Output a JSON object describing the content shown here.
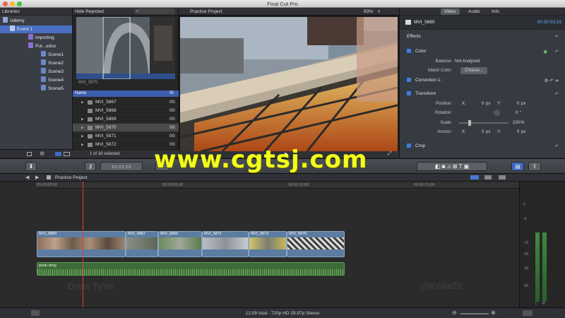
{
  "window": {
    "title": "Final Cut Pro"
  },
  "libraries": {
    "header": "Libraries",
    "items": [
      {
        "label": "Udemy"
      },
      {
        "label": "Event 1"
      },
      {
        "label": "importing"
      },
      {
        "label": "Put...edux"
      },
      {
        "label": "Scene1"
      },
      {
        "label": "Scene2"
      },
      {
        "label": "Scene3"
      },
      {
        "label": "Scene4"
      },
      {
        "label": "Scene5"
      }
    ]
  },
  "browser": {
    "filter": "Hide Rejected",
    "filmstrip_label": "MVI_5870",
    "columns": {
      "name": "Name",
      "status": "St"
    },
    "rows": [
      {
        "name": "MVI_5867",
        "status": "00:"
      },
      {
        "name": "MVI_5868",
        "status": "00:"
      },
      {
        "name": "MVI_5869",
        "status": "00:"
      },
      {
        "name": "MVI_5870",
        "status": "00:"
      },
      {
        "name": "MVI_5871",
        "status": "00:"
      },
      {
        "name": "MVI_5872",
        "status": "00:"
      }
    ],
    "selection": "1 of 16 selected"
  },
  "viewer": {
    "project": "Practice Project",
    "zoom": "93%"
  },
  "inspector": {
    "tabs": [
      "Video",
      "Audio",
      "Info"
    ],
    "clip_name": "MVI_5880",
    "timecode": "00:00:03;16",
    "effects": "Effects",
    "color": {
      "title": "Color",
      "balance_label": "Balance:",
      "balance_value": "Not Analyzed",
      "match_label": "Match Color:",
      "choose": "Choose..."
    },
    "correction": "Correction 1:",
    "transform": {
      "title": "Transform",
      "position_label": "Position:",
      "x_label": "X:",
      "x_val": "0",
      "y_label": "Y:",
      "y_val": "0",
      "px": "px",
      "rotation_label": "Rotation:",
      "rotation_val": "0",
      "deg": "°",
      "scale_label": "Scale:",
      "scale_val": "100",
      "pct": "%",
      "anchor_label": "Anchor:",
      "ax_val": "0",
      "ay_val": "0"
    },
    "crop": "Crop"
  },
  "timeline": {
    "project": "Practice Project",
    "ruler": [
      "00:00:00;00",
      "00:00:05;00",
      "00:00:10;00",
      "00:00:15;00"
    ],
    "clips": [
      {
        "name": "MVI_5880"
      },
      {
        "name": "MVI_5867"
      },
      {
        "name": "MVI_5869"
      },
      {
        "name": "MVI_5871"
      },
      {
        "name": "MVI_5873"
      },
      {
        "name": "MVI_5870"
      }
    ],
    "audio": "punk-drop",
    "meter_scale": [
      "0",
      "-6",
      "-12",
      "-20",
      "-30",
      "-50"
    ],
    "meter_lr": [
      "L",
      "R"
    ]
  },
  "status": {
    "text": "12;09 total - 720p HD 29.97p Stereo"
  },
  "overlay": {
    "watermark": "www.cgtsj.com",
    "presenter": "Drew Tyler",
    "handle": "@Knite20"
  },
  "colors": {
    "accent": "#4a6fc2",
    "playhead": "#e03b3b",
    "audio": "#3d6c3a",
    "watermark": "#f3ff1a"
  }
}
